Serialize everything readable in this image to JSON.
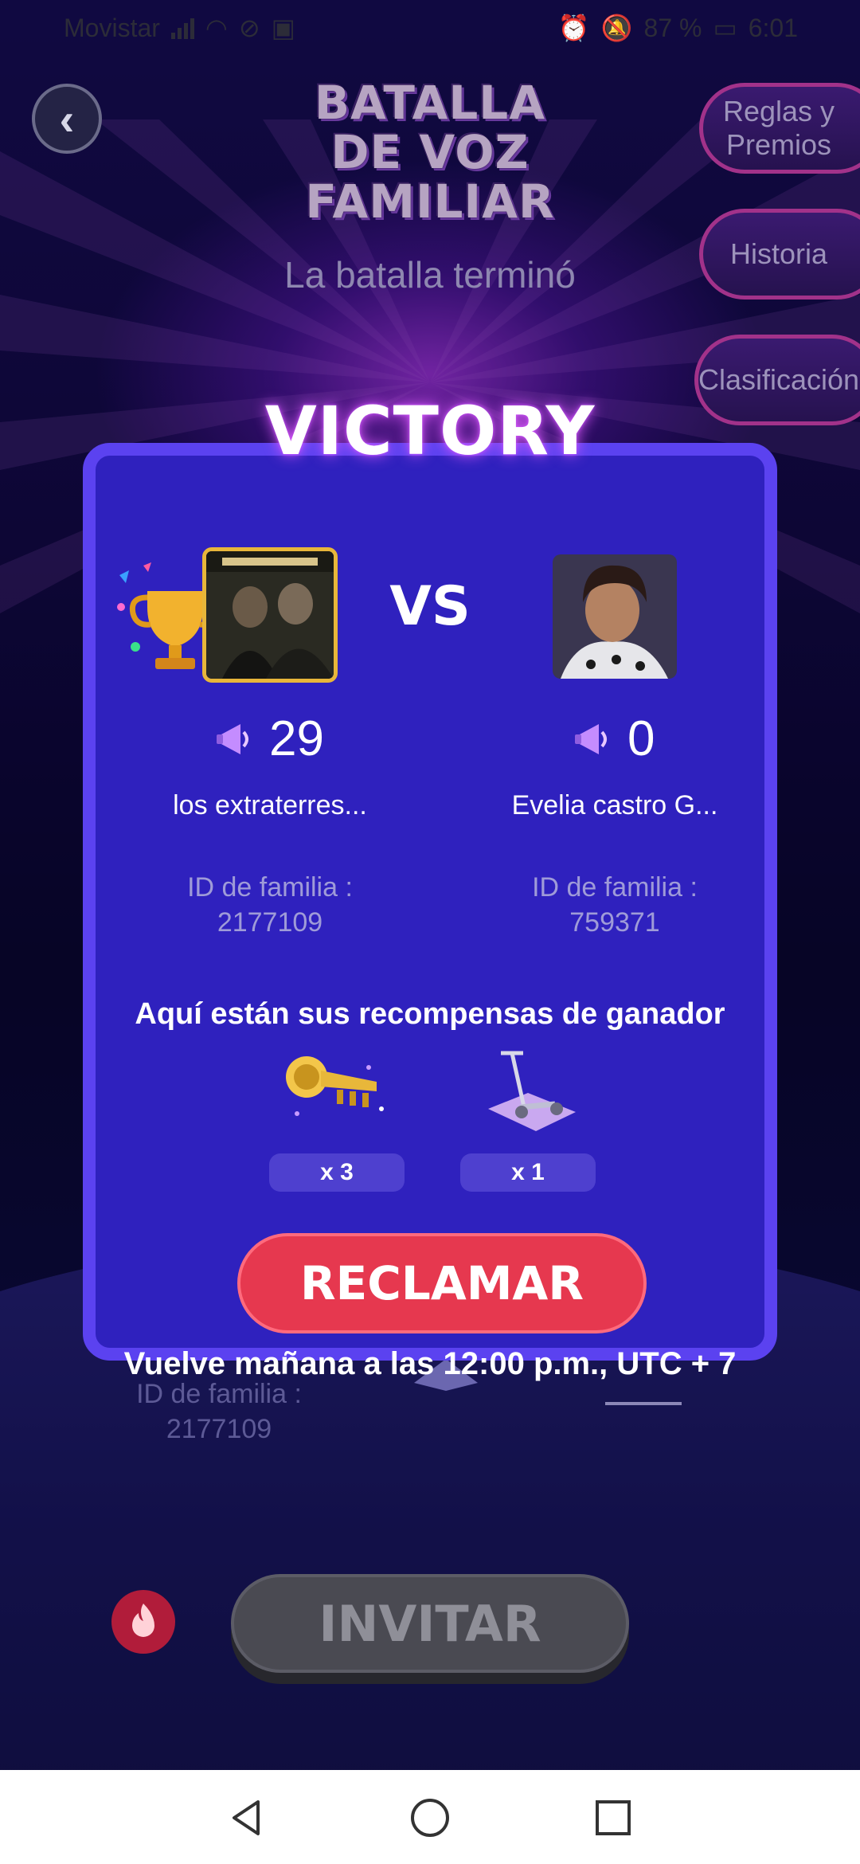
{
  "status_bar": {
    "carrier": "Movistar",
    "battery": "87 %",
    "time": "6:01"
  },
  "header": {
    "title_lines": [
      "BATALLA",
      "DE VOZ",
      "FAMILIAR"
    ],
    "subtitle": "La batalla terminó"
  },
  "side_menu": {
    "rules": "Reglas y Premios",
    "history": "Historia",
    "ranking": "Clasificación"
  },
  "result": {
    "banner": "VICTORY",
    "vs": "VS",
    "winner": {
      "score": "29",
      "name": "los extraterres...",
      "family_id_label": "ID de familia :",
      "family_id": "2177109"
    },
    "opponent": {
      "score": "0",
      "name": "Evelia castro G...",
      "family_id_label": "ID de familia :",
      "family_id": "759371"
    }
  },
  "rewards": {
    "title": "Aquí están sus recompensas de ganador",
    "items": [
      {
        "icon": "trumpet-icon",
        "qty": "x 3"
      },
      {
        "icon": "scooter-icon",
        "qty": "x 1"
      }
    ]
  },
  "claim_button": "RECLAMAR",
  "return_note": "Vuelve mañana a las 12:00 p.m., UTC + 7",
  "background": {
    "family_id_label": "ID de familia :",
    "family_id": "2177109"
  },
  "invite_button": "INVITAR",
  "colors": {
    "modal": "#2f21be",
    "modal_border": "#5b42f0",
    "claim": "#e6384f",
    "accent_glow": "#b84cff"
  }
}
